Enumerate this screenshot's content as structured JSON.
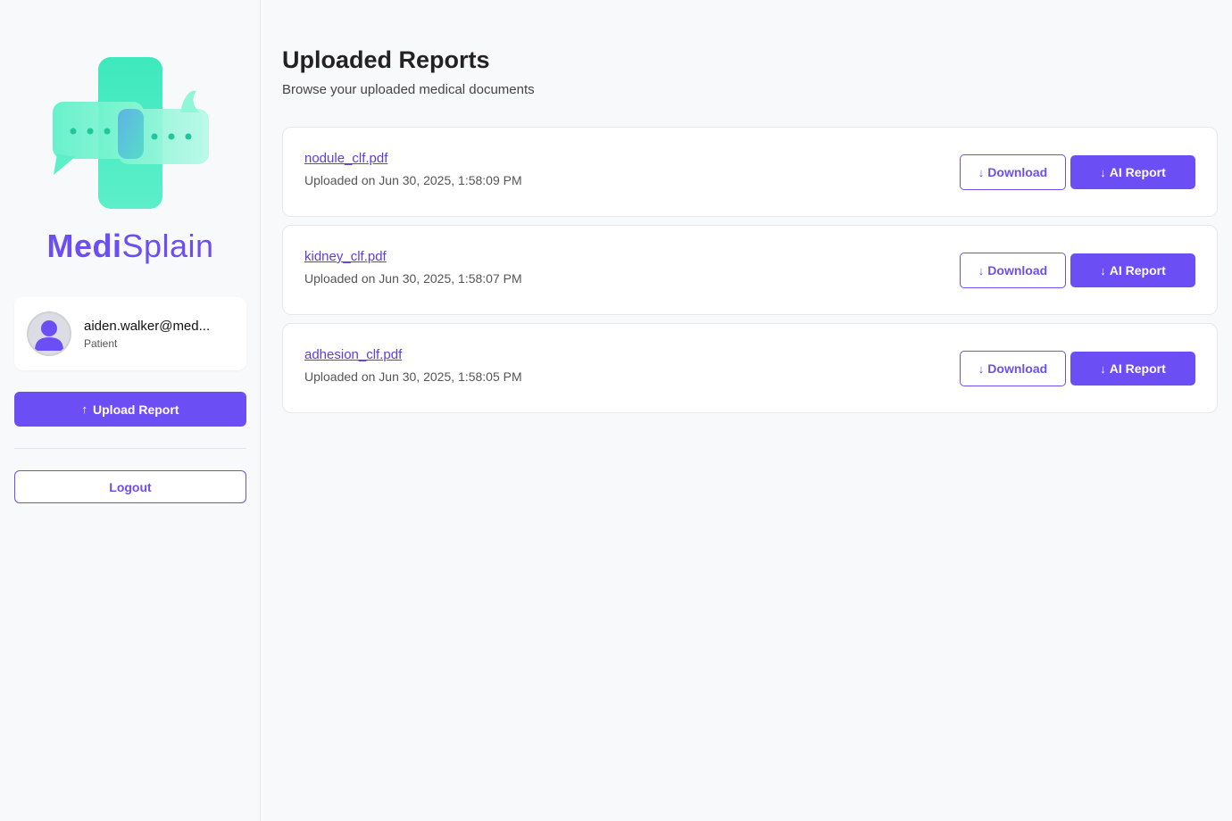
{
  "brand": {
    "part1": "Medi",
    "part2": "Splain"
  },
  "user": {
    "email": "aiden.walker@med...",
    "role": "Patient"
  },
  "sidebar": {
    "upload_icon": "upload-arrow-icon",
    "upload_arrow": "↑",
    "upload_label": "Upload Report",
    "logout_label": "Logout"
  },
  "header": {
    "title": "Uploaded Reports",
    "subtitle": "Browse your uploaded medical documents"
  },
  "reports": [
    {
      "name": "nodule_clf.pdf",
      "uploaded": "Uploaded on Jun 30, 2025, 1:58:09 PM"
    },
    {
      "name": "kidney_clf.pdf",
      "uploaded": "Uploaded on Jun 30, 2025, 1:58:07 PM"
    },
    {
      "name": "adhesion_clf.pdf",
      "uploaded": "Uploaded on Jun 30, 2025, 1:58:05 PM"
    }
  ],
  "actions": {
    "download_arrow": "↓",
    "download_label": "Download",
    "ai_arrow": "↓",
    "ai_label": "AI Report"
  },
  "colors": {
    "accent": "#6c4ef5",
    "logo_green": "#3de8b8",
    "background": "#f8f9fb"
  }
}
